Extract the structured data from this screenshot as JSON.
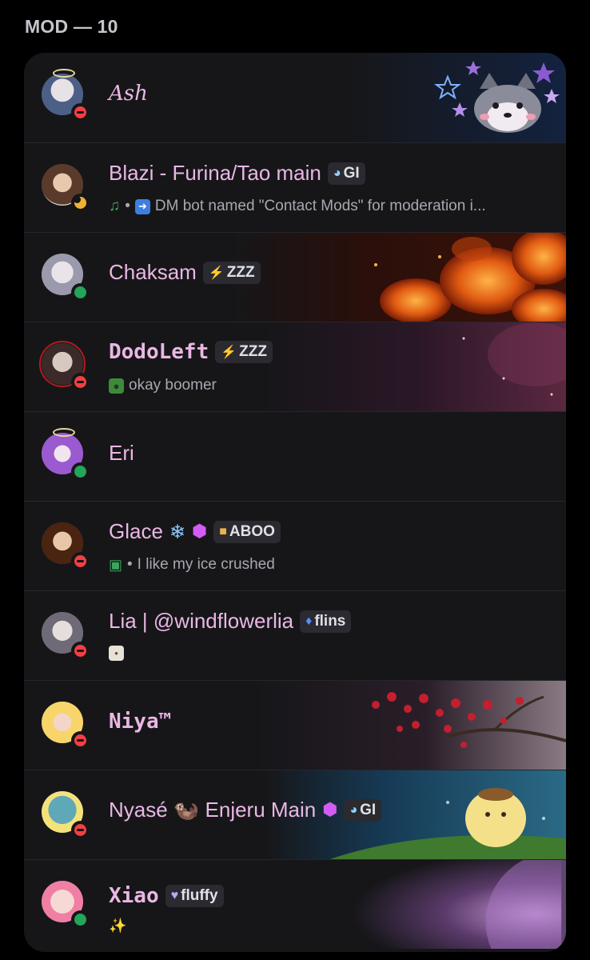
{
  "section": {
    "title": "MOD — 10"
  },
  "members": [
    {
      "name": "Ash",
      "status": "dnd",
      "tag": null,
      "status_text": ""
    },
    {
      "name": "Blazi - Furina/Tao main",
      "status": "idle",
      "tag": {
        "icon": "genshin-icon",
        "label": "GI"
      },
      "status_text": "DM bot named \"Contact Mods\" for moderation i...",
      "activity_icons": [
        "music-note-icon",
        "arrow-right-icon"
      ]
    },
    {
      "name": "Chaksam",
      "status": "online",
      "tag": {
        "icon": "lightning-icon",
        "label": "ZZZ"
      },
      "status_text": ""
    },
    {
      "name": "DodoLeft",
      "status": "dnd",
      "tag": {
        "icon": "lightning-icon",
        "label": "ZZZ"
      },
      "status_text": "okay boomer",
      "activity_icons": [
        "pepe-emoji-icon"
      ]
    },
    {
      "name": "Eri",
      "status": "online",
      "tag": null,
      "status_text": ""
    },
    {
      "name": "Glace",
      "status": "dnd",
      "name_icons": [
        "snowflake-icon",
        "boost-gem-icon"
      ],
      "tag": {
        "icon": "cat-icon",
        "label": "ABOO"
      },
      "status_text": "I like my ice crushed",
      "activity_icons": [
        "gamepad-icon"
      ]
    },
    {
      "name": "Lia | @windflowerlia",
      "status": "dnd",
      "tag": {
        "icon": "flame-icon",
        "label": "flins"
      },
      "status_text": "",
      "activity_icons": [
        "dog-emoji-icon"
      ]
    },
    {
      "name": "Niya™",
      "status": "dnd",
      "tag": null,
      "status_text": ""
    },
    {
      "name": "Nyasé 🦦 Enjeru Main",
      "status": "dnd",
      "name_icons": [
        "boost-gem-icon"
      ],
      "tag": {
        "icon": "genshin-icon",
        "label": "GI"
      },
      "status_text": ""
    },
    {
      "name": "Xiao",
      "status": "online",
      "tag": {
        "icon": "heart-icon",
        "label": "fluffy"
      },
      "status_text": "",
      "activity_icons": [
        "sparkle-emoji-icon"
      ]
    }
  ],
  "colors": {
    "background": "#000000",
    "panel": "#161619",
    "name": "#eab7e4",
    "dnd": "#f23f43",
    "online": "#23a55a",
    "idle": "#f0b232"
  }
}
